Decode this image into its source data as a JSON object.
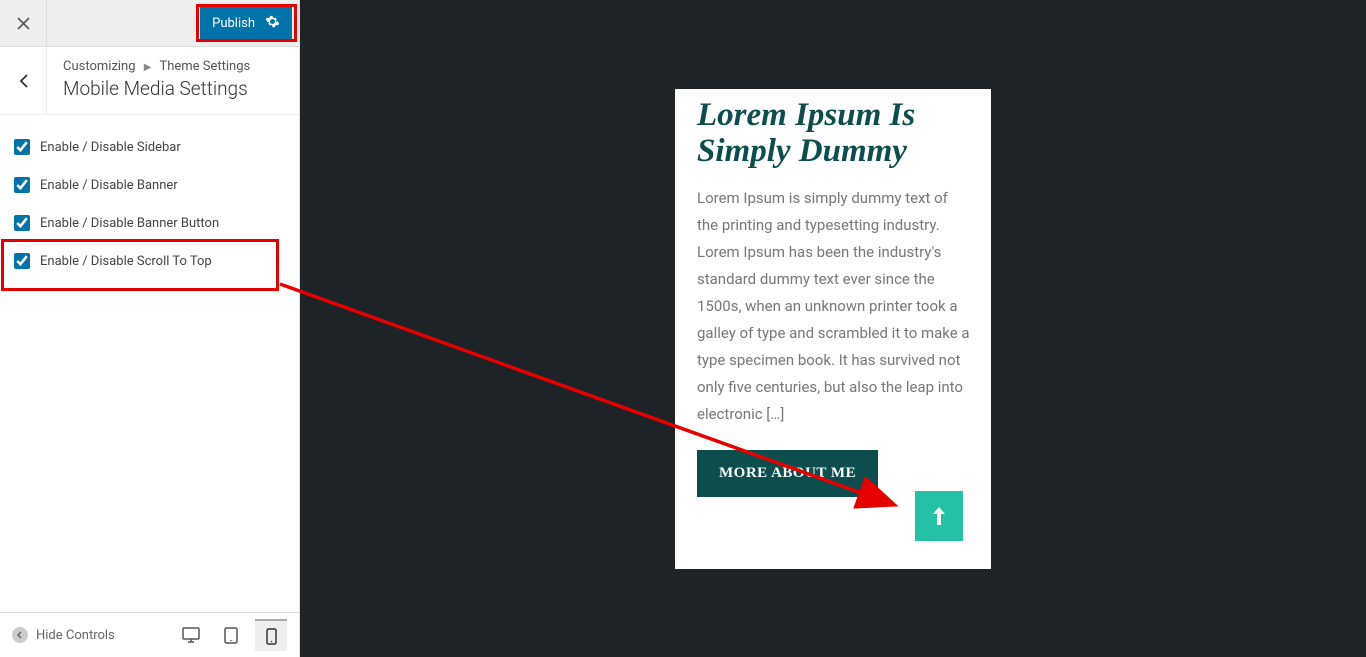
{
  "header": {
    "publish_label": "Publish"
  },
  "crumb": {
    "customizing": "Customizing",
    "parent": "Theme Settings",
    "title": "Mobile Media Settings"
  },
  "settings": [
    {
      "label": "Enable / Disable Sidebar",
      "checked": true
    },
    {
      "label": "Enable / Disable Banner",
      "checked": true
    },
    {
      "label": "Enable / Disable Banner Button",
      "checked": true
    },
    {
      "label": "Enable / Disable Scroll To Top",
      "checked": true
    }
  ],
  "footer": {
    "hide_controls": "Hide Controls"
  },
  "preview": {
    "title": "Lorem Ipsum Is Simply Dummy",
    "body": "Lorem Ipsum is simply dummy text of the printing and typesetting industry. Lorem Ipsum has been the industry's standard dummy text ever since the 1500s, when an unknown printer took a galley of type and scrambled it to make a type specimen book. It has survived not only five centuries, but also the leap into electronic […]",
    "more_btn": "MORE ABOUT ME"
  }
}
